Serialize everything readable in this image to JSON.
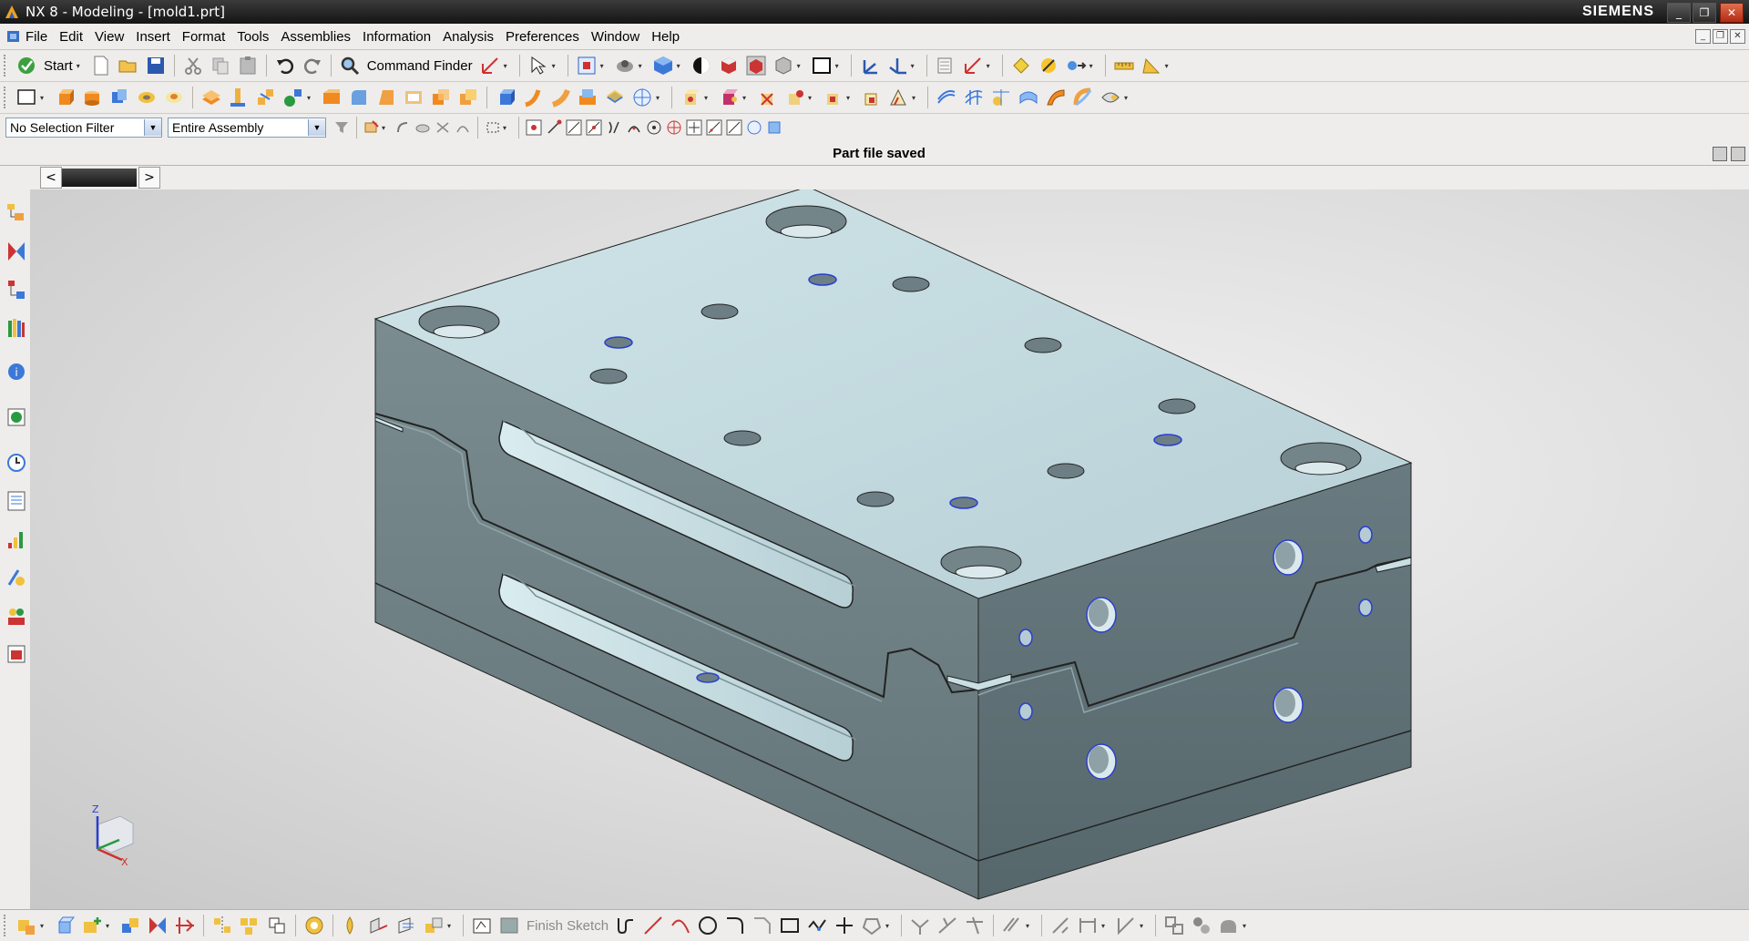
{
  "window": {
    "title": "NX 8 - Modeling - [mold1.prt]",
    "brand": "SIEMENS",
    "controls": {
      "minimize": "_",
      "maximize": "❐",
      "close": "✕"
    }
  },
  "menubar": {
    "items": [
      "File",
      "Edit",
      "View",
      "Insert",
      "Format",
      "Tools",
      "Assemblies",
      "Information",
      "Analysis",
      "Preferences",
      "Window",
      "Help"
    ]
  },
  "toolbar1": {
    "start_label": "Start",
    "command_finder_label": "Command Finder"
  },
  "selection": {
    "filter_value": "No Selection Filter",
    "scope_value": "Entire Assembly"
  },
  "status": {
    "message": "Part file saved"
  },
  "tabs": {
    "prev": "<",
    "next": ">"
  },
  "triad": {
    "z_label": "Z",
    "x_label": "X"
  },
  "bottom_toolbar": {
    "finish_sketch_label": "Finish Sketch"
  },
  "colors": {
    "title_bar": "#1c1c1c",
    "model_top": "#c3dbe0",
    "model_side": "#6b7d82",
    "model_front": "#5e6f74",
    "hole_edge": "#2a3ecf"
  }
}
